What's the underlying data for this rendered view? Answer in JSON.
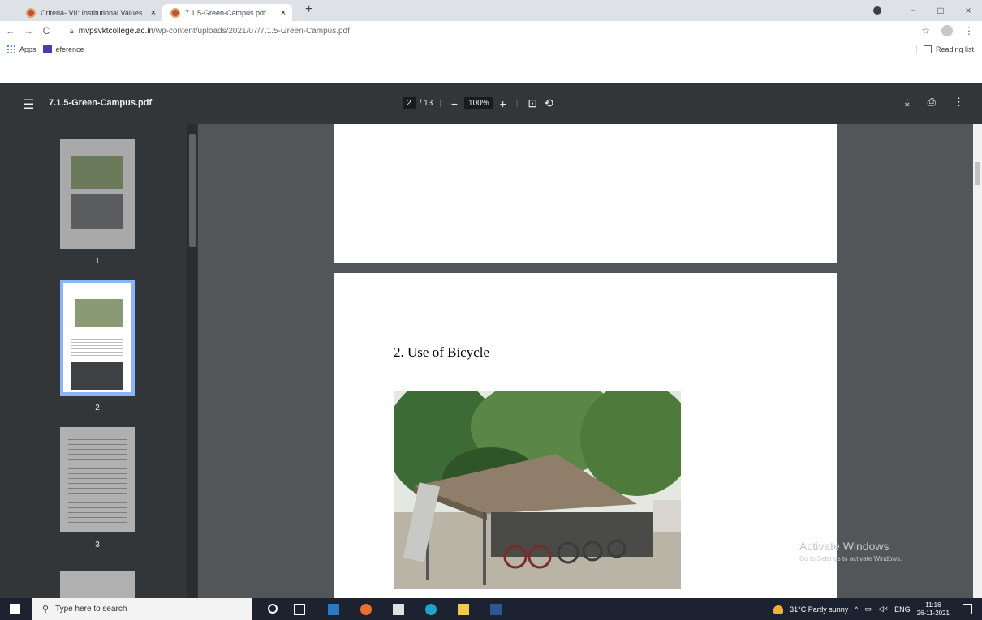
{
  "tabs": [
    {
      "title": "Criteria- VII: Institutional Values",
      "close": "×"
    },
    {
      "title": "7.1.5-Green-Campus.pdf",
      "close": "×"
    }
  ],
  "new_tab": "+",
  "window_controls": {
    "minimize": "−",
    "maximize": "□",
    "close": "×"
  },
  "address_bar": {
    "host": "mvpsvktcollege.ac.in",
    "path": "/wp-content/uploads/2021/07/7.1.5-Green-Campus.pdf"
  },
  "bookmarks": [
    {
      "label": "Apps"
    },
    {
      "label": "eference"
    }
  ],
  "reading_list": "Reading list",
  "pdf": {
    "filename": "7.1.5-Green-Campus.pdf",
    "page_current": "2",
    "page_total": "/ 13",
    "zoom": "100%",
    "page2_heading": "2. Use of Bicycle"
  },
  "thumbnails": [
    {
      "label": "1",
      "selected": false
    },
    {
      "label": "2",
      "selected": true
    },
    {
      "label": "3",
      "selected": false
    }
  ],
  "watermark": {
    "line1": "Activate Windows",
    "line2": "Go to Settings to activate Windows."
  },
  "taskbar": {
    "search_placeholder": "Type here to search",
    "weather": "31°C  Partly sunny",
    "language": "ENG",
    "time": "11:16",
    "date": "26-11-2021"
  }
}
